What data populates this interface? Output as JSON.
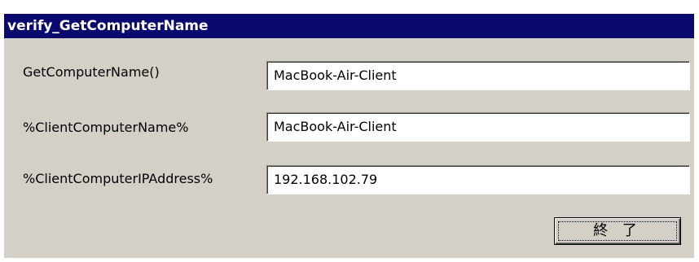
{
  "window": {
    "title": "verify_GetComputerName"
  },
  "rows": [
    {
      "label": "GetComputerName()",
      "value": "MacBook-Air-Client"
    },
    {
      "label": "%ClientComputerName%",
      "value": "MacBook-Air-Client"
    },
    {
      "label": "%ClientComputerIPAddress%",
      "value": "192.168.102.79"
    }
  ],
  "buttons": {
    "close_label": "終 了"
  },
  "colors": {
    "titlebar": "#0a0a6e",
    "window_bg": "#d4d0c8"
  }
}
